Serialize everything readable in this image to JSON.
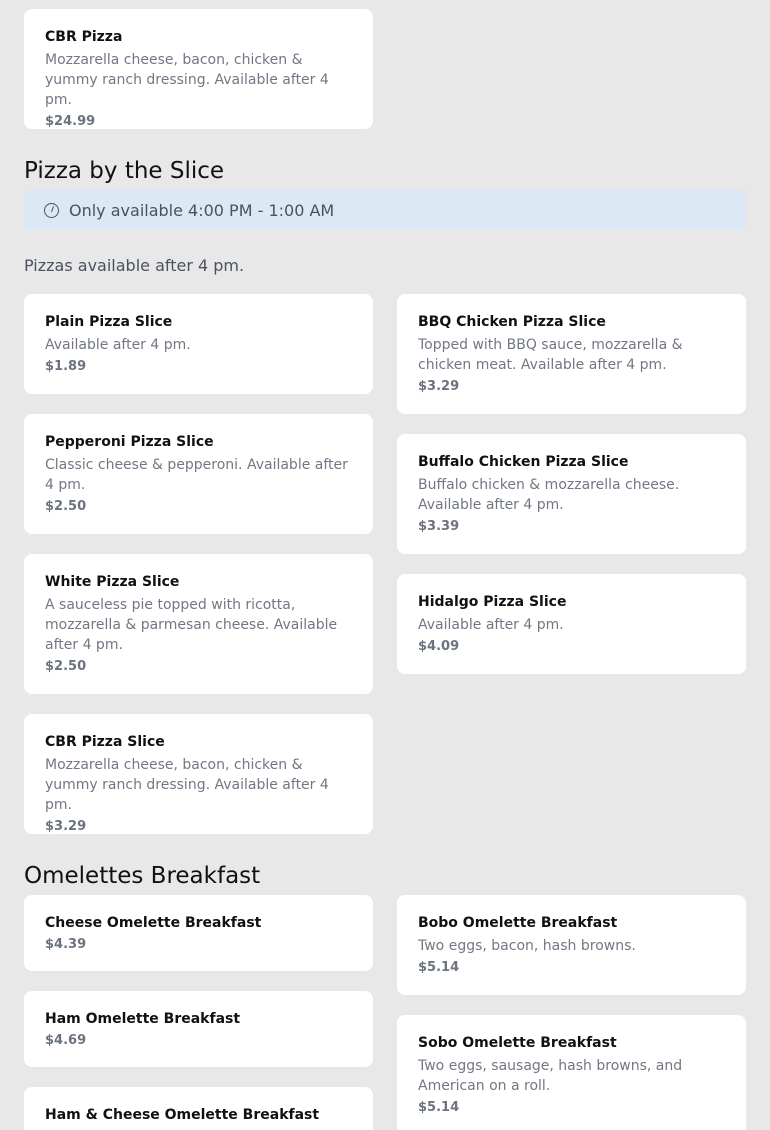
{
  "top_card": {
    "title": "CBR Pizza",
    "desc": "Mozzarella cheese, bacon, chicken & yummy ranch dressing. Available after 4 pm.",
    "price": "$24.99"
  },
  "slice_section": {
    "title": "Pizza by the Slice",
    "notice": "Only available 4:00 PM - 1:00 AM",
    "subtext": "Pizzas available after 4 pm.",
    "left_items": [
      {
        "title": "Plain Pizza Slice",
        "desc": "Available after 4 pm.",
        "price": "$1.89"
      },
      {
        "title": "Pepperoni Pizza Slice",
        "desc": "Classic cheese & pepperoni. Available after 4 pm.",
        "price": "$2.50"
      },
      {
        "title": "White Pizza Slice",
        "desc": "A sauceless pie topped with ricotta, mozzarella & parmesan cheese. Available after 4 pm.",
        "price": "$2.50"
      },
      {
        "title": "CBR Pizza Slice",
        "desc": "Mozzarella cheese, bacon, chicken & yummy ranch dressing. Available after 4 pm.",
        "price": "$3.29"
      }
    ],
    "right_items": [
      {
        "title": "BBQ Chicken Pizza Slice",
        "desc": "Topped with BBQ sauce, mozzarella & chicken meat. Available after 4 pm.",
        "price": "$3.29"
      },
      {
        "title": "Buffalo Chicken Pizza Slice",
        "desc": "Buffalo chicken & mozzarella cheese. Available after 4 pm.",
        "price": "$3.39"
      },
      {
        "title": "Hidalgo Pizza Slice",
        "desc": "Available after 4 pm.",
        "price": "$4.09"
      }
    ]
  },
  "omelette_section": {
    "title": "Omelettes Breakfast",
    "left_items": [
      {
        "title": "Cheese Omelette Breakfast",
        "price": "$4.39"
      },
      {
        "title": "Ham Omelette Breakfast",
        "price": "$4.69"
      },
      {
        "title": "Ham & Cheese Omelette Breakfast",
        "price": ""
      }
    ],
    "right_items": [
      {
        "title": "Bobo Omelette Breakfast",
        "desc": "Two eggs, bacon, hash browns.",
        "price": "$5.14"
      },
      {
        "title": "Sobo Omelette Breakfast",
        "desc": "Two eggs, sausage, hash browns, and American on a roll.",
        "price": "$5.14"
      }
    ]
  },
  "icons": {
    "notice_icon": "clock-icon"
  }
}
